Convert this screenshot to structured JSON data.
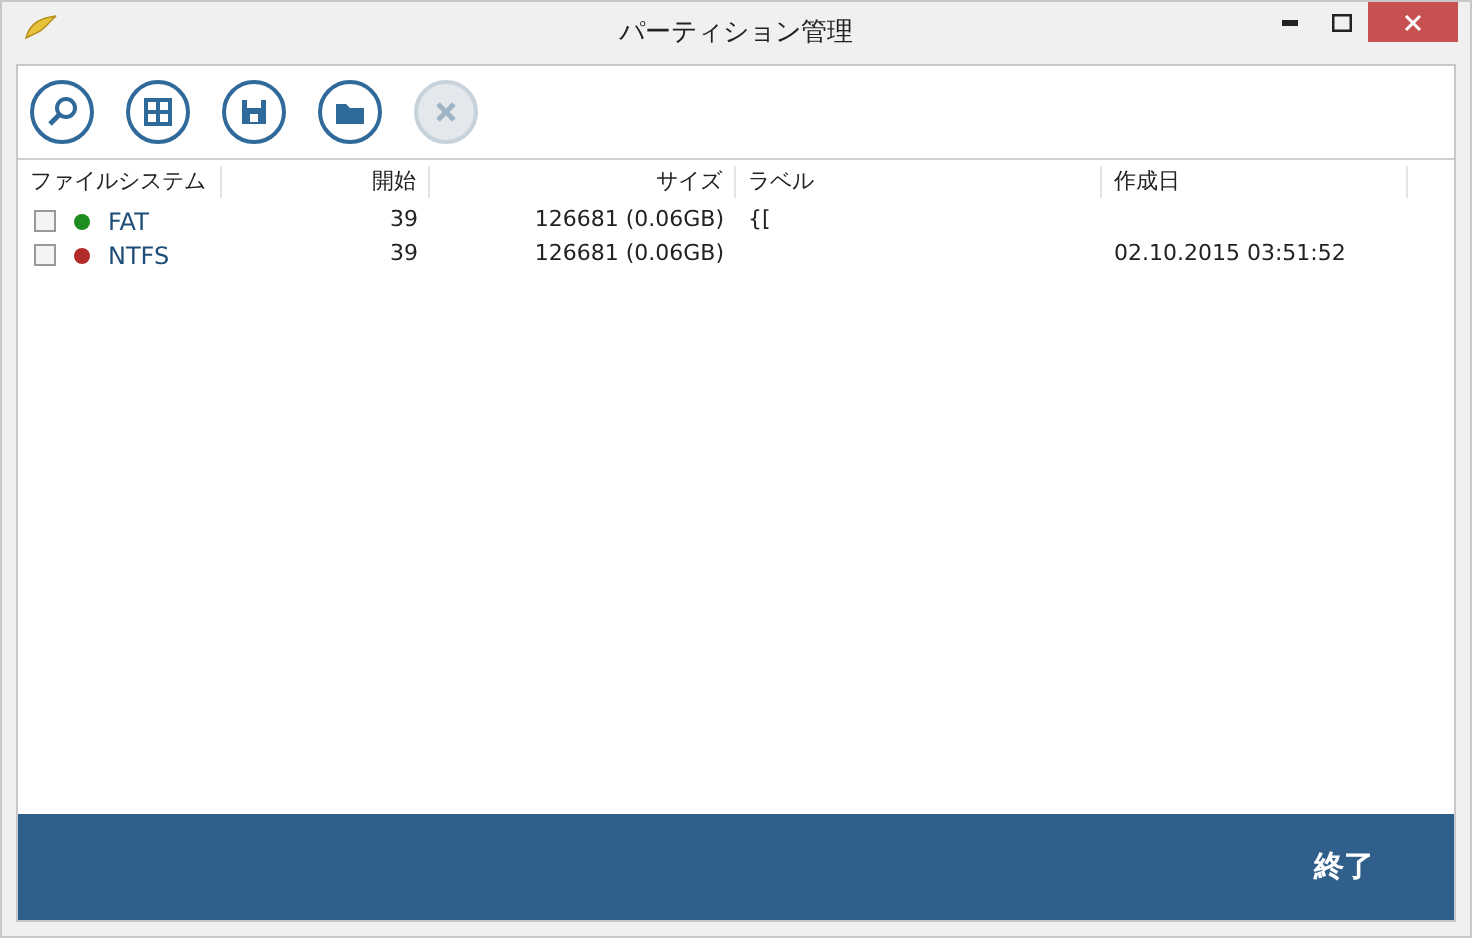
{
  "window": {
    "title": "パーティション管理"
  },
  "toolbar": [
    {
      "kind": "search",
      "disabled": false
    },
    {
      "kind": "grid",
      "disabled": false
    },
    {
      "kind": "save",
      "disabled": false
    },
    {
      "kind": "folder",
      "disabled": false
    },
    {
      "kind": "cancel",
      "disabled": true
    }
  ],
  "table": {
    "columns": [
      "ファイルシステム",
      "開始",
      "サイズ",
      "ラベル",
      "作成日"
    ],
    "rows": [
      {
        "checked": false,
        "color": "#1e8c1e",
        "file_system": "FAT",
        "start": "39",
        "size": "126681 (0.06GB)",
        "label": "{[",
        "created": ""
      },
      {
        "checked": false,
        "color": "#b22a2a",
        "file_system": "NTFS",
        "start": "39",
        "size": "126681 (0.06GB)",
        "label": "",
        "created": "02.10.2015 03:51:52"
      }
    ]
  },
  "footer": {
    "button": "終了"
  }
}
